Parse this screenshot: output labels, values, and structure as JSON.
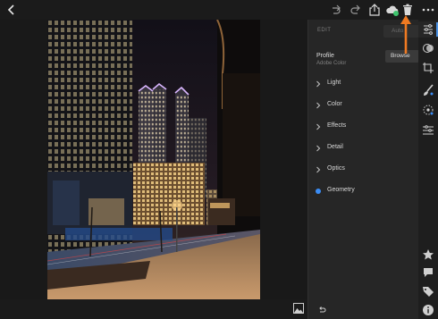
{
  "edit_panel": {
    "title": "EDIT",
    "auto_label": "Auto",
    "profile_label": "Profile",
    "profile_value": "Adobe Color",
    "browse_label": "Browse",
    "sections": [
      "Light",
      "Color",
      "Effects",
      "Detail",
      "Optics",
      "Geometry"
    ]
  },
  "colors": {
    "accent": "#3b8df5",
    "annotation_arrow": "#f07a22",
    "cloud_status": "#3ec46d"
  },
  "icons": {
    "top": [
      "back-icon",
      "redo-icon",
      "undo-icon",
      "share-icon",
      "cloud-sync-icon",
      "trash-icon",
      "more-icon"
    ],
    "rail": [
      "edit-sliders-icon",
      "presets-icon",
      "crop-icon",
      "healing-brush-icon",
      "selective-icon",
      "versions-icon",
      "star-icon",
      "comment-icon",
      "tag-icon",
      "info-icon"
    ]
  }
}
